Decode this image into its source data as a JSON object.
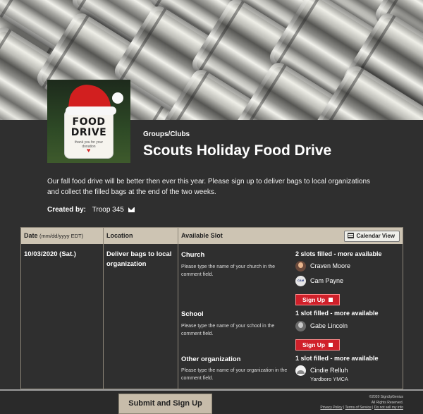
{
  "page": {
    "category": "Groups/Clubs",
    "title": "Scouts Holiday Food Drive",
    "description": "Our fall food drive will be better then ever this year.  Please sign up to deliver bags to local organizations and collect the filled bags at the end of the two weeks.",
    "created_by_label": "Created by:",
    "created_by_value": "Troop 345",
    "logo_text": "FOOD DRIVE",
    "logo_subtext": "thank you for your donation"
  },
  "table": {
    "headers": {
      "date": "Date",
      "date_format": "(mm/dd/yyyy EDT)",
      "location": "Location",
      "slot": "Available Slot"
    },
    "calendar_button": "Calendar View",
    "date": "10/03/2020 (Sat.)",
    "location": "Deliver bags to local organization",
    "slots": [
      {
        "title": "Church",
        "note": "Please type the name of your church in the comment field.",
        "status": "2 slots filled - more available",
        "people": [
          {
            "name": "Craven Moore",
            "avatar": "photo-avatar"
          },
          {
            "name": "Cam Payne",
            "avatar": "badge-avatar"
          }
        ],
        "button": "Sign Up"
      },
      {
        "title": "School",
        "note": "Please type the name of your school in the comment field.",
        "status": "1 slot filled - more available",
        "people": [
          {
            "name": "Gabe Lincoln",
            "avatar": "photo-avatar"
          }
        ],
        "button": "Sign Up"
      },
      {
        "title": "Other organization",
        "note": "Please type the name of your organization in the comment field.",
        "status": "1 slot filled - more available",
        "people": [
          {
            "name": "Cindie Relluh",
            "avatar": "default-avatar",
            "comment": "Yardboro YMCA"
          }
        ]
      }
    ]
  },
  "footer": {
    "submit": "Submit and Sign Up",
    "copyright": "©2020 SignUpGenius",
    "rights": "All Rights Reserved.",
    "privacy": "Privacy Policy",
    "terms": "Terms of Service",
    "donotsell": "Do not sell my info"
  },
  "colors": {
    "background": "#2f2f2f",
    "header_row": "#cdc4b3",
    "signup_button": "#d0202a",
    "submit_button": "#c7bcaa"
  }
}
